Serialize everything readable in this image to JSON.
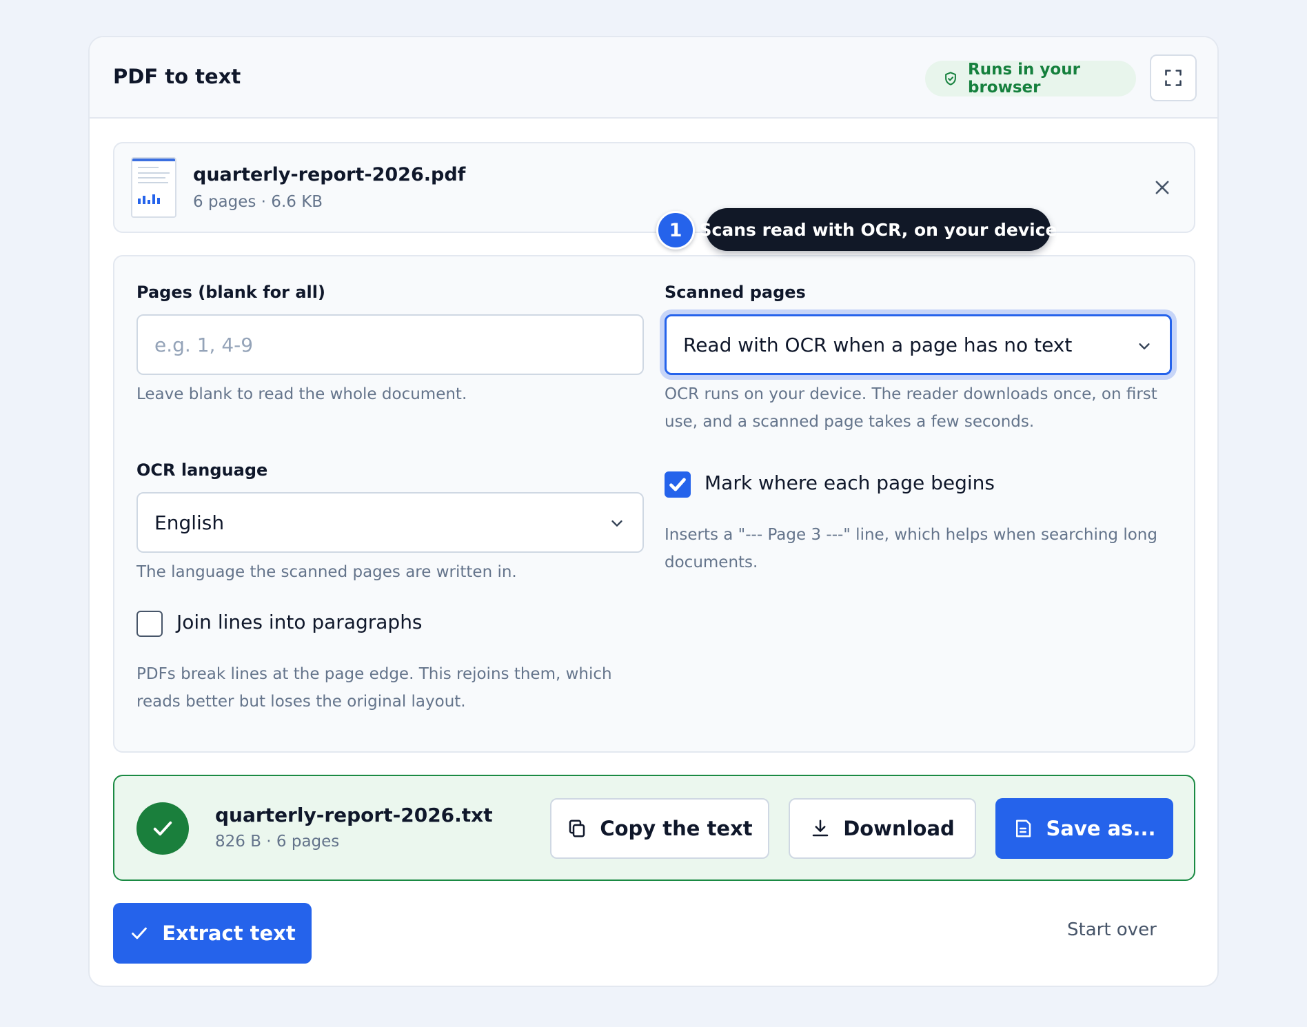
{
  "header": {
    "title": "PDF to text",
    "badge_label": "Runs in your browser",
    "badge_icon": "shield-check-icon",
    "expand_icon": "expand-icon"
  },
  "file": {
    "name": "quarterly-report-2026.pdf",
    "meta": "6 pages · 6.6 KB",
    "remove_icon": "close-icon"
  },
  "tooltip": {
    "number": "1",
    "text": "Scans read with OCR, on your device"
  },
  "options": {
    "pages": {
      "label": "Pages (blank for all)",
      "value": "",
      "placeholder": "e.g. 1, 4-9",
      "hint": "Leave blank to read the whole document."
    },
    "scanned": {
      "label": "Scanned pages",
      "selected": "Read with OCR when a page has no text",
      "hint": "OCR runs on your device. The reader downloads once, on first use, and a scanned page takes a few seconds."
    },
    "ocr_language": {
      "label": "OCR language",
      "selected": "English",
      "hint": "The language the scanned pages are written in."
    },
    "mark_pages": {
      "label": "Mark where each page begins",
      "checked": true,
      "hint": "Inserts a \"--- Page 3 ---\" line, which helps when searching long documents."
    },
    "join_lines": {
      "label": "Join lines into paragraphs",
      "checked": false,
      "hint": "PDFs break lines at the page edge. This rejoins them, which reads better but loses the original layout."
    }
  },
  "result": {
    "name": "quarterly-report-2026.txt",
    "meta": "826 B · 6 pages",
    "copy_label": "Copy the text",
    "download_label": "Download",
    "save_label": "Save as..."
  },
  "actions": {
    "extract_label": "Extract text",
    "start_over_label": "Start over"
  },
  "colors": {
    "accent": "#2563eb",
    "success": "#1a7f3c",
    "badge_text": "#15803d"
  }
}
